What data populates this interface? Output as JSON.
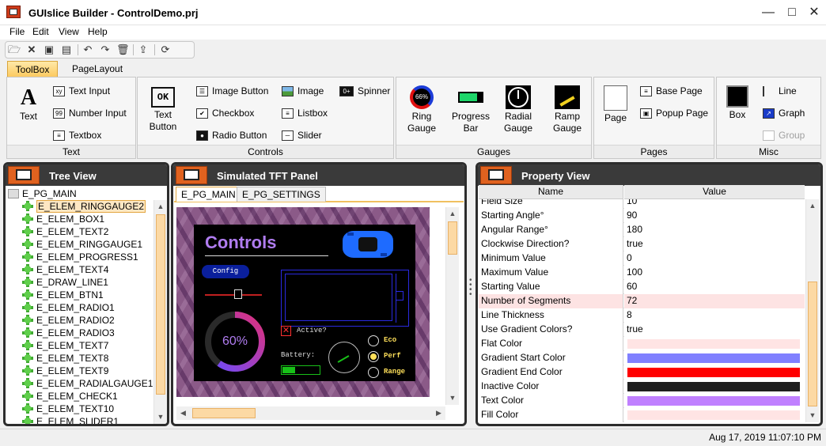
{
  "window": {
    "title": "GUIslice Builder - ControlDemo.prj",
    "controls": [
      "minimize-icon",
      "maximize-icon",
      "close-icon"
    ]
  },
  "menu": [
    "File",
    "Edit",
    "View",
    "Help"
  ],
  "toolbar_icons": [
    "open-folder-icon",
    "close-icon",
    "save-icon",
    "save-all-icon",
    "undo-icon",
    "redo-icon",
    "delete-icon",
    "export-icon",
    "refresh-icon"
  ],
  "ribbon_tabs": [
    "ToolBox",
    "PageLayout"
  ],
  "ribbon": {
    "text_group": {
      "label": "Text",
      "big": "Text",
      "items": [
        "Text Input",
        "Number Input",
        "Textbox"
      ]
    },
    "controls_group": {
      "label": "Controls",
      "big_line1": "Text",
      "big_line2": "Button",
      "big_icon_text": "OK",
      "col1": [
        "Image Button",
        "Checkbox",
        "Radio Button"
      ],
      "col2": [
        "Image",
        "Listbox",
        "Slider"
      ],
      "col3": [
        "Spinner"
      ]
    },
    "gauges_group": {
      "label": "Gauges",
      "ring_icon_text": "66%",
      "items": [
        {
          "line1": "Ring",
          "line2": "Gauge"
        },
        {
          "line1": "Progress",
          "line2": "Bar"
        },
        {
          "line1": "Radial",
          "line2": "Gauge"
        },
        {
          "line1": "Ramp",
          "line2": "Gauge"
        }
      ]
    },
    "pages_group": {
      "label": "Pages",
      "big": "Page",
      "items": [
        "Base Page",
        "Popup Page"
      ]
    },
    "misc_group": {
      "label": "Misc",
      "big": "Box",
      "items": [
        "Line",
        "Graph",
        "Group"
      ]
    }
  },
  "tree_view": {
    "title": "Tree View",
    "root": "E_PG_MAIN",
    "selected_index": 0,
    "items": [
      "E_ELEM_RINGGAUGE2",
      "E_ELEM_BOX1",
      "E_ELEM_TEXT2",
      "E_ELEM_RINGGAUGE1",
      "E_ELEM_PROGRESS1",
      "E_ELEM_TEXT4",
      "E_DRAW_LINE1",
      "E_ELEM_BTN1",
      "E_ELEM_RADIO1",
      "E_ELEM_RADIO2",
      "E_ELEM_RADIO3",
      "E_ELEM_TEXT7",
      "E_ELEM_TEXT8",
      "E_ELEM_TEXT9",
      "E_ELEM_RADIALGAUGE1",
      "E_ELEM_CHECK1",
      "E_ELEM_TEXT10",
      "E_ELEM_SLIDER1"
    ]
  },
  "tft_panel": {
    "title": "Simulated TFT Panel",
    "tabs": [
      "E_PG_MAIN",
      "E_PG_SETTINGS"
    ],
    "screen": {
      "heading": "Controls",
      "config_button": "Config",
      "ring_value": "60%",
      "ring_fraction": 0.6,
      "active_label": "Active?",
      "battery_label": "Battery:",
      "battery_level": 0.35,
      "radio_labels": [
        "Eco",
        "Perf",
        "Range"
      ],
      "radio_selected": 1,
      "colors": {
        "heading": "#b07cf0",
        "config_bg": "#0a1f9c",
        "accent_blue": "#2a2ae0",
        "radio_text": "#ffe05a",
        "battery": "#18c018",
        "check_red": "#ff3030"
      }
    }
  },
  "property_view": {
    "title": "Property View",
    "col_name": "Name",
    "col_value": "Value",
    "rows": [
      {
        "name": "Field Size",
        "value": "10"
      },
      {
        "name": "Starting Angle°",
        "value": "90"
      },
      {
        "name": "Angular Range°",
        "value": "180"
      },
      {
        "name": "Clockwise Direction?",
        "value": "true"
      },
      {
        "name": "Minimum Value",
        "value": "0"
      },
      {
        "name": "Maximum Value",
        "value": "100"
      },
      {
        "name": "Starting Value",
        "value": "60"
      },
      {
        "name": "Number of Segments",
        "value": "72",
        "highlight": true
      },
      {
        "name": "Line Thickness",
        "value": "8"
      },
      {
        "name": "Use Gradient Colors?",
        "value": "true"
      },
      {
        "name": "Flat Color",
        "color": "#ffe4e4"
      },
      {
        "name": "Gradient Start Color",
        "color": "#8080ff"
      },
      {
        "name": "Gradient End Color",
        "color": "#ff0000"
      },
      {
        "name": "Inactive Color",
        "color": "#1e1e1e"
      },
      {
        "name": "Text Color",
        "color": "#c080ff"
      },
      {
        "name": "Fill Color",
        "color": "#ffe4e4"
      }
    ]
  },
  "status": {
    "timestamp": "Aug 17, 2019 11:07:10 PM"
  }
}
